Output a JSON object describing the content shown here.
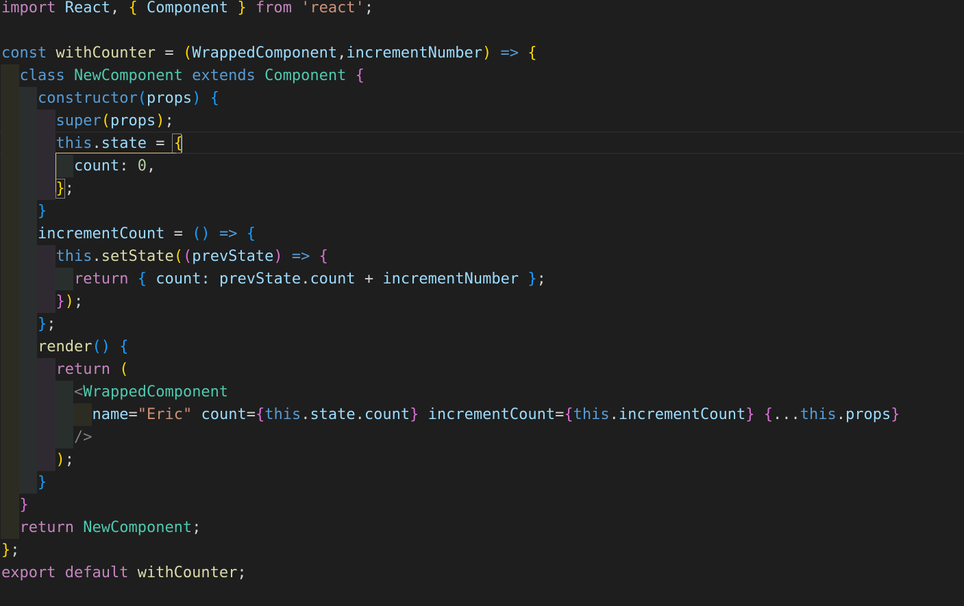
{
  "editor": {
    "language": "javascript",
    "cursor": {
      "line": 7,
      "column": 19
    }
  },
  "colors": {
    "background": "#1e1e1e",
    "keyword_control": "#c586c0",
    "keyword_storage": "#569cd6",
    "variable": "#9cdcfe",
    "function": "#dcdcaa",
    "class_name": "#4ec9b0",
    "string": "#ce9178",
    "number": "#b5cea8",
    "punctuation": "#d4d4d4",
    "bracket_gold": "#ffd700",
    "bracket_purple": "#da70d6",
    "bracket_blue": "#179fff",
    "tag_bracket": "#808080"
  },
  "indent_guide_colors": [
    "#2c2c23",
    "#2a2e2e",
    "#2f2a31",
    "#292f2c"
  ],
  "lines": [
    {
      "indent": 0,
      "tokens": [
        [
          "import",
          "keyword_control"
        ],
        [
          " ",
          "punctuation"
        ],
        [
          "React",
          "variable"
        ],
        [
          ", ",
          "punctuation"
        ],
        [
          "{",
          "bracket_gold"
        ],
        [
          " ",
          "punctuation"
        ],
        [
          "Component",
          "variable"
        ],
        [
          " ",
          "punctuation"
        ],
        [
          "}",
          "bracket_gold"
        ],
        [
          " ",
          "punctuation"
        ],
        [
          "from",
          "keyword_control"
        ],
        [
          " ",
          "punctuation"
        ],
        [
          "'react'",
          "string"
        ],
        [
          ";",
          "punctuation"
        ]
      ]
    },
    {
      "indent": 0,
      "tokens": []
    },
    {
      "indent": 0,
      "tokens": [
        [
          "const",
          "keyword_storage"
        ],
        [
          " ",
          "punctuation"
        ],
        [
          "withCounter",
          "function"
        ],
        [
          " = ",
          "punctuation"
        ],
        [
          "(",
          "bracket_gold"
        ],
        [
          "WrappedComponent",
          "variable"
        ],
        [
          ",",
          "punctuation"
        ],
        [
          "incrementNumber",
          "variable"
        ],
        [
          ")",
          "bracket_gold"
        ],
        [
          " ",
          "punctuation"
        ],
        [
          "=>",
          "keyword_storage"
        ],
        [
          " ",
          "punctuation"
        ],
        [
          "{",
          "bracket_gold"
        ]
      ]
    },
    {
      "indent": 1,
      "tokens": [
        [
          "class",
          "keyword_storage"
        ],
        [
          " ",
          "punctuation"
        ],
        [
          "NewComponent",
          "class_name"
        ],
        [
          " ",
          "punctuation"
        ],
        [
          "extends",
          "keyword_storage"
        ],
        [
          " ",
          "punctuation"
        ],
        [
          "Component",
          "class_name"
        ],
        [
          " ",
          "punctuation"
        ],
        [
          "{",
          "bracket_purple"
        ]
      ]
    },
    {
      "indent": 2,
      "tokens": [
        [
          "constructor",
          "keyword_storage"
        ],
        [
          "(",
          "bracket_blue"
        ],
        [
          "props",
          "variable"
        ],
        [
          ")",
          "bracket_blue"
        ],
        [
          " ",
          "punctuation"
        ],
        [
          "{",
          "bracket_blue"
        ]
      ]
    },
    {
      "indent": 3,
      "tokens": [
        [
          "super",
          "keyword_storage"
        ],
        [
          "(",
          "bracket_gold"
        ],
        [
          "props",
          "variable"
        ],
        [
          ")",
          "bracket_gold"
        ],
        [
          ";",
          "punctuation"
        ]
      ]
    },
    {
      "indent": 3,
      "tokens": [
        [
          "this",
          "keyword_storage"
        ],
        [
          ".",
          "punctuation"
        ],
        [
          "state",
          "variable"
        ],
        [
          " = ",
          "punctuation"
        ],
        [
          "{",
          "bracket_gold"
        ]
      ]
    },
    {
      "indent": 4,
      "tokens": [
        [
          "count",
          "variable"
        ],
        [
          ": ",
          "punctuation"
        ],
        [
          "0",
          "number"
        ],
        [
          ",",
          "punctuation"
        ]
      ]
    },
    {
      "indent": 3,
      "tokens": [
        [
          "}",
          "bracket_gold"
        ],
        [
          ";",
          "punctuation"
        ]
      ]
    },
    {
      "indent": 2,
      "tokens": [
        [
          "}",
          "bracket_blue"
        ]
      ]
    },
    {
      "indent": 2,
      "tokens": [
        [
          "incrementCount",
          "variable"
        ],
        [
          " = ",
          "punctuation"
        ],
        [
          "()",
          "bracket_blue"
        ],
        [
          " ",
          "punctuation"
        ],
        [
          "=>",
          "keyword_storage"
        ],
        [
          " ",
          "punctuation"
        ],
        [
          "{",
          "bracket_blue"
        ]
      ]
    },
    {
      "indent": 3,
      "tokens": [
        [
          "this",
          "keyword_storage"
        ],
        [
          ".",
          "punctuation"
        ],
        [
          "setState",
          "function"
        ],
        [
          "(",
          "bracket_gold"
        ],
        [
          "(",
          "bracket_purple"
        ],
        [
          "prevState",
          "variable"
        ],
        [
          ")",
          "bracket_purple"
        ],
        [
          " ",
          "punctuation"
        ],
        [
          "=>",
          "keyword_storage"
        ],
        [
          " ",
          "punctuation"
        ],
        [
          "{",
          "bracket_purple"
        ]
      ]
    },
    {
      "indent": 4,
      "tokens": [
        [
          "return",
          "keyword_control"
        ],
        [
          " ",
          "punctuation"
        ],
        [
          "{",
          "bracket_blue"
        ],
        [
          " ",
          "punctuation"
        ],
        [
          "count",
          "variable"
        ],
        [
          ": ",
          "variable"
        ],
        [
          "prevState",
          "variable"
        ],
        [
          ".",
          "punctuation"
        ],
        [
          "count",
          "variable"
        ],
        [
          " + ",
          "punctuation"
        ],
        [
          "incrementNumber",
          "variable"
        ],
        [
          " ",
          "punctuation"
        ],
        [
          "}",
          "bracket_blue"
        ],
        [
          ";",
          "punctuation"
        ]
      ]
    },
    {
      "indent": 3,
      "tokens": [
        [
          "}",
          "bracket_purple"
        ],
        [
          ")",
          "bracket_gold"
        ],
        [
          ";",
          "punctuation"
        ]
      ]
    },
    {
      "indent": 2,
      "tokens": [
        [
          "}",
          "bracket_blue"
        ],
        [
          ";",
          "punctuation"
        ]
      ]
    },
    {
      "indent": 2,
      "tokens": [
        [
          "render",
          "function"
        ],
        [
          "()",
          "bracket_blue"
        ],
        [
          " ",
          "punctuation"
        ],
        [
          "{",
          "bracket_blue"
        ]
      ]
    },
    {
      "indent": 3,
      "tokens": [
        [
          "return",
          "keyword_control"
        ],
        [
          " ",
          "punctuation"
        ],
        [
          "(",
          "bracket_gold"
        ]
      ]
    },
    {
      "indent": 4,
      "tokens": [
        [
          "<",
          "tag_bracket"
        ],
        [
          "WrappedComponent",
          "class_name"
        ]
      ]
    },
    {
      "indent": 5,
      "tokens": [
        [
          "name",
          "variable"
        ],
        [
          "=",
          "punctuation"
        ],
        [
          "\"Eric\"",
          "string"
        ],
        [
          " ",
          "punctuation"
        ],
        [
          "count",
          "variable"
        ],
        [
          "=",
          "punctuation"
        ],
        [
          "{",
          "bracket_purple"
        ],
        [
          "this",
          "keyword_storage"
        ],
        [
          ".",
          "punctuation"
        ],
        [
          "state",
          "variable"
        ],
        [
          ".",
          "punctuation"
        ],
        [
          "count",
          "variable"
        ],
        [
          "}",
          "bracket_purple"
        ],
        [
          " ",
          "punctuation"
        ],
        [
          "incrementCount",
          "variable"
        ],
        [
          "=",
          "punctuation"
        ],
        [
          "{",
          "bracket_purple"
        ],
        [
          "this",
          "keyword_storage"
        ],
        [
          ".",
          "punctuation"
        ],
        [
          "incrementCount",
          "variable"
        ],
        [
          "}",
          "bracket_purple"
        ],
        [
          " ",
          "punctuation"
        ],
        [
          "{",
          "bracket_purple"
        ],
        [
          "...",
          "punctuation"
        ],
        [
          "this",
          "keyword_storage"
        ],
        [
          ".",
          "punctuation"
        ],
        [
          "props",
          "variable"
        ],
        [
          "}",
          "bracket_purple"
        ]
      ]
    },
    {
      "indent": 4,
      "tokens": [
        [
          "/>",
          "tag_bracket"
        ]
      ]
    },
    {
      "indent": 3,
      "tokens": [
        [
          ")",
          "bracket_gold"
        ],
        [
          ";",
          "punctuation"
        ]
      ]
    },
    {
      "indent": 2,
      "tokens": [
        [
          "}",
          "bracket_blue"
        ]
      ]
    },
    {
      "indent": 1,
      "tokens": [
        [
          "}",
          "bracket_purple"
        ]
      ]
    },
    {
      "indent": 1,
      "tokens": [
        [
          "return",
          "keyword_control"
        ],
        [
          " ",
          "punctuation"
        ],
        [
          "NewComponent",
          "class_name"
        ],
        [
          ";",
          "punctuation"
        ]
      ]
    },
    {
      "indent": 0,
      "tokens": [
        [
          "}",
          "bracket_gold"
        ],
        [
          ";",
          "punctuation"
        ]
      ]
    },
    {
      "indent": 0,
      "tokens": [
        [
          "export",
          "keyword_control"
        ],
        [
          " ",
          "punctuation"
        ],
        [
          "default",
          "keyword_control"
        ],
        [
          " ",
          "punctuation"
        ],
        [
          "withCounter",
          "function"
        ],
        [
          ";",
          "punctuation"
        ]
      ]
    }
  ]
}
